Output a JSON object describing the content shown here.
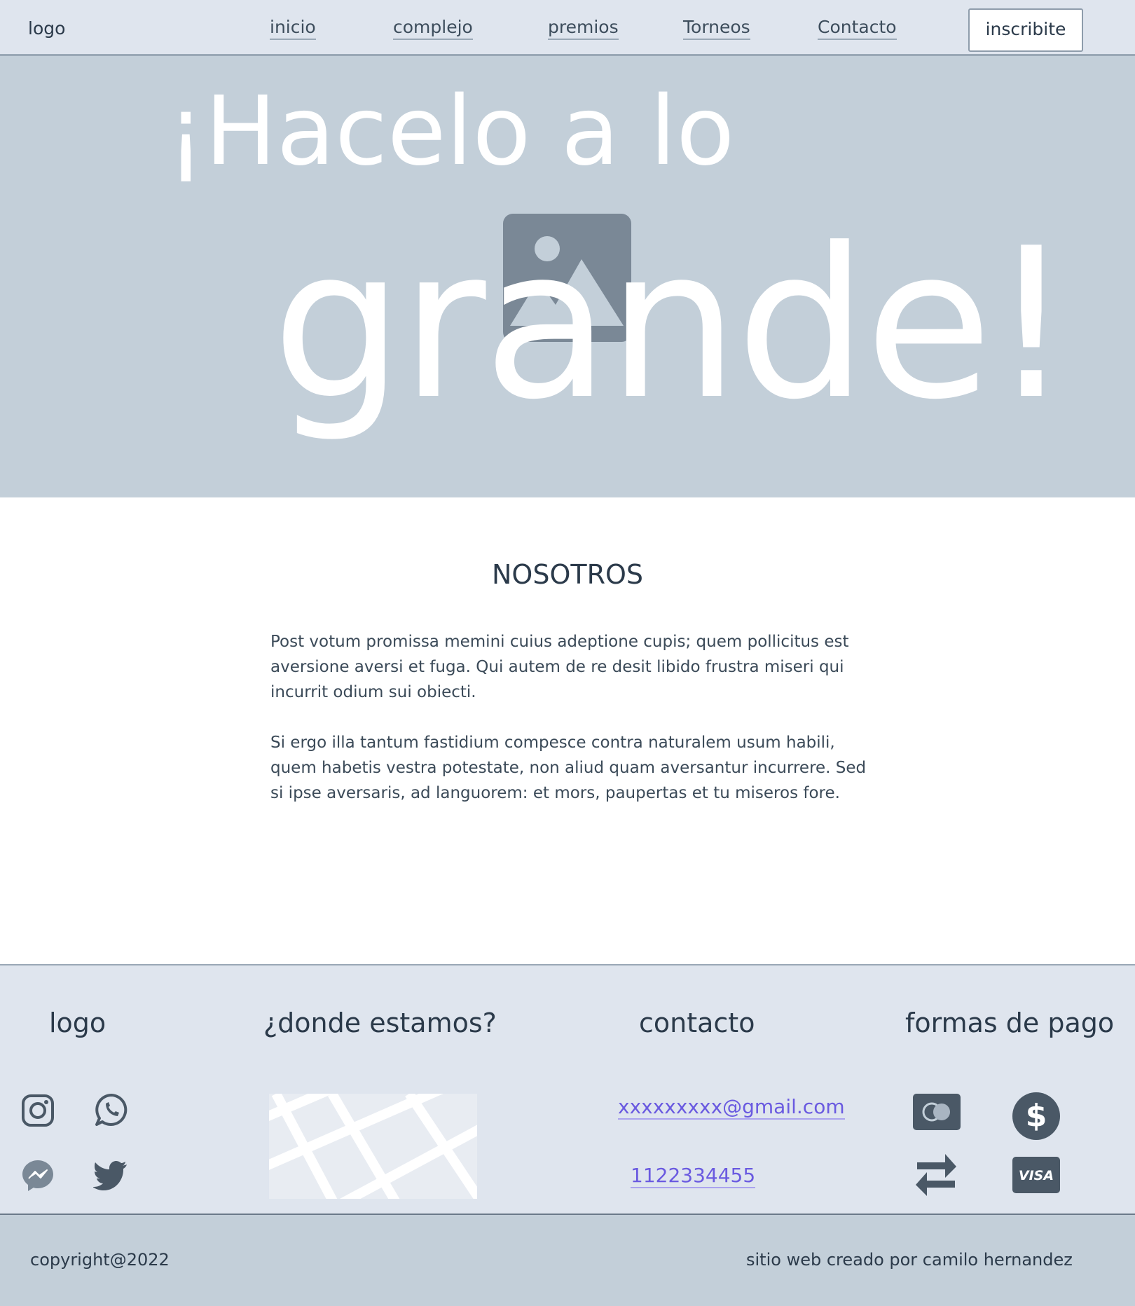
{
  "nav": {
    "logo": "logo",
    "links": [
      "inicio",
      "complejo",
      "premios",
      "Torneos",
      "Contacto"
    ],
    "cta": "inscribite"
  },
  "hero": {
    "line1": "¡Hacelo a lo",
    "line2": "grande!",
    "image_icon": "image-placeholder-icon"
  },
  "about": {
    "title": "NOSOTROS",
    "paragraphs": [
      "Post votum promissa memini cuius adeptione cupis; quem pollicitus est aversione aversi et fuga. Qui autem de re desit libido frustra miseri qui incurrit odium sui obiecti.",
      "Si ergo illa tantum fastidium compesce contra naturalem usum habili, quem habetis vestra potestate, non aliud quam aversantur incurrere. Sed si ipse aversaris, ad languorem: et mors, paupertas et tu miseros fore."
    ]
  },
  "footer": {
    "logo": "logo",
    "location_title": "¿donde estamos?",
    "contact_title": "contacto",
    "payment_title": "formas de pago",
    "email": "xxxxxxxxx@gmail.com",
    "phone": "1122334455",
    "social_icons": [
      "instagram-icon",
      "whatsapp-icon",
      "messenger-icon",
      "twitter-icon"
    ],
    "payment_icons": [
      "mastercard-icon",
      "dollar-icon",
      "transfer-icon",
      "visa-icon"
    ],
    "visa_text": "VISA"
  },
  "bottom": {
    "copyright": "copyright@2022",
    "credits": "sitio web creado por camilo hernandez"
  },
  "colors": {
    "nav_bg": "#dfe5ee",
    "hero_bg": "#c3cfd9",
    "icon_dark": "#4a5866",
    "link": "#6a5ae0"
  }
}
